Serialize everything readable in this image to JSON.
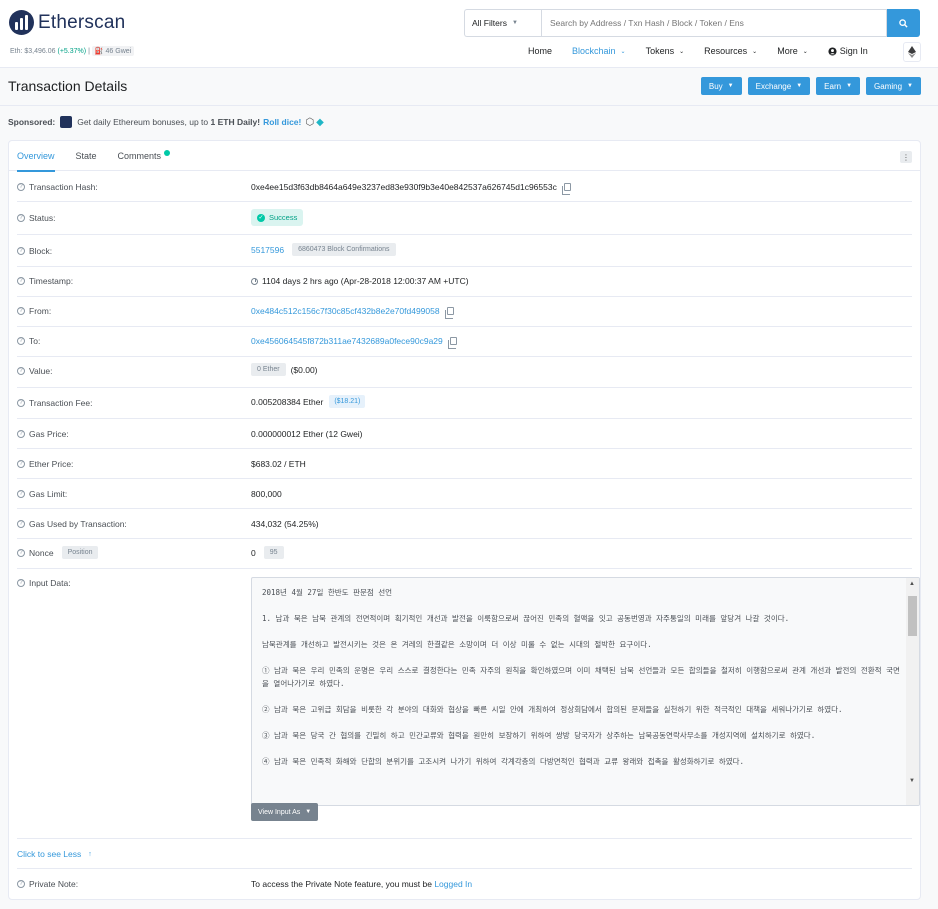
{
  "header": {
    "logo_text": "Etherscan",
    "eth_price_label": "Eth: $3,496.06",
    "eth_price_change": "(+5.37%)",
    "separator": "|",
    "gas_label": "46 Gwei",
    "search": {
      "filter_label": "All Filters",
      "placeholder": "Search by Address / Txn Hash / Block / Token / Ens"
    },
    "nav": [
      {
        "label": "Home",
        "active": false,
        "dropdown": false
      },
      {
        "label": "Blockchain",
        "active": true,
        "dropdown": true
      },
      {
        "label": "Tokens",
        "active": false,
        "dropdown": true
      },
      {
        "label": "Resources",
        "active": false,
        "dropdown": true
      },
      {
        "label": "More",
        "active": false,
        "dropdown": true
      }
    ],
    "sign_in": "Sign In"
  },
  "title": {
    "text": "Transaction Details",
    "buttons": [
      "Buy",
      "Exchange",
      "Earn",
      "Gaming"
    ]
  },
  "sponsored": {
    "label": "Sponsored:",
    "text": "Get daily Ethereum bonuses, up to",
    "bold": "1 ETH Daily!",
    "link": "Roll dice!"
  },
  "tabs": [
    "Overview",
    "State",
    "Comments"
  ],
  "details": {
    "tx_hash_label": "Transaction Hash:",
    "tx_hash": "0xe4ee15d3f63db8464a649e3237ed83e930f9b3e40e842537a626745d1c96553c",
    "status_label": "Status:",
    "status": "Success",
    "block_label": "Block:",
    "block": "5517596",
    "block_confirmations": "6860473 Block Confirmations",
    "timestamp_label": "Timestamp:",
    "timestamp": "1104 days 2 hrs ago (Apr-28-2018 12:00:37 AM +UTC)",
    "from_label": "From:",
    "from": "0xe484c512c156c7f30c85cf432b8e2e70fd499058",
    "to_label": "To:",
    "to": "0xe456064545f872b311ae7432689a0fece90c9a29",
    "value_label": "Value:",
    "value_eth": "0 Ether",
    "value_usd": "($0.00)",
    "fee_label": "Transaction Fee:",
    "fee": "0.005208384 Ether",
    "fee_usd": "($18.21)",
    "gas_price_label": "Gas Price:",
    "gas_price": "0.000000012 Ether (12 Gwei)",
    "ether_price_label": "Ether Price:",
    "ether_price": "$683.02 / ETH",
    "gas_limit_label": "Gas Limit:",
    "gas_limit": "800,000",
    "gas_used_label": "Gas Used by Transaction:",
    "gas_used": "434,032 (54.25%)",
    "nonce_label": "Nonce",
    "nonce_position": "Position",
    "nonce": "0",
    "position": "95",
    "input_label": "Input Data:",
    "input_paragraphs": [
      "2018년 4월 27일 한반도 판문점 선언",
      "1. 남과 북은 남북 관계의 전면적이며 획기적인 개선과 발전을 이룩함으로써 끊어진 민족의 혈맥을 잇고 공동번영과 자주통일의 미래를 앞당겨 나갈 것이다.",
      "남북관계를 개선하고 발전시키는 것은 온 겨레의 한결같은 소망이며 더 이상 미룰 수 없는 시대의 절박한 요구이다.",
      "① 남과 북은 우리 민족의 운명은 우리 스스로 결정한다는 민족 자주의 원칙을 확인하였으며 이미 채택된 남북 선언들과 모든 합의들을 철저히 이행함으로써 관계 개선과 발전의 전환적 국면을 열어나가기로 하였다.",
      "② 남과 북은 고위급 회담을 비롯한 각 분야의 대화와 협상을 빠른 시일 안에 개최하여 정상회담에서 합의된 문제들을 실천하기 위한 적극적인 대책을 세워나가기로 하였다.",
      "③ 남과 북은 당국 간 협의를 긴밀히 하고 민간교류와 협력을 원만히 보장하기 위하여 쌍방 당국자가 상주하는 남북공동연락사무소를 개성지역에 설치하기로 하였다.",
      "④ 남과 북은 민족적 화해와 단합의 분위기를 고조시켜 나가기 위하여 각계각층의 다방면적인 협력과 교류 왕래와 접촉을 활성화하기로 하였다."
    ],
    "view_input_as": "View Input As",
    "click_less": "Click to see Less",
    "private_note_label": "Private Note:",
    "private_note_text": "To access the Private Note feature, you must be",
    "private_note_link": "Logged In"
  },
  "colors": {
    "accent": "#3498db",
    "success": "#00c9a7",
    "brand_dark": "#21325b"
  }
}
